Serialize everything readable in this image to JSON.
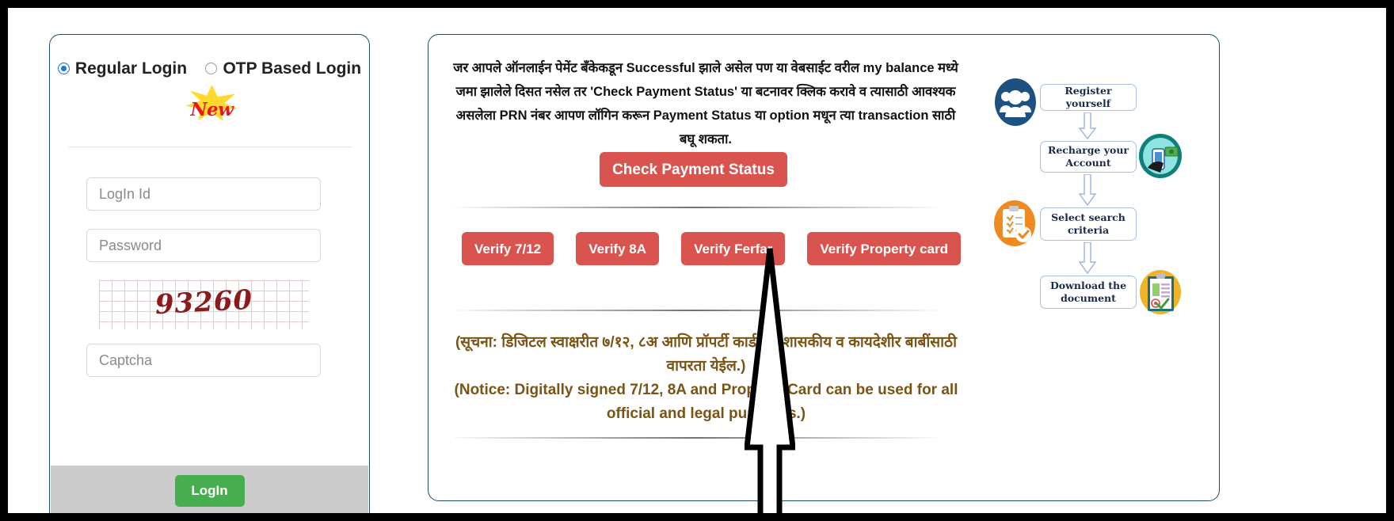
{
  "login": {
    "options": [
      {
        "label": "Regular Login",
        "selected": true
      },
      {
        "label": "OTP Based Login",
        "selected": false
      }
    ],
    "new_badge": "New",
    "fields": {
      "login_id_placeholder": "LogIn Id",
      "login_id_value": "",
      "password_placeholder": "Password",
      "password_value": "",
      "captcha_placeholder": "Captcha",
      "captcha_value": ""
    },
    "captcha_code": "93260",
    "submit_label": "LogIn"
  },
  "main": {
    "notice_marathi": "जर आपले ऑनलाईन पेमेंट बँकेकडून Successful झाले असेल पण या वेबसाईट वरील my balance मध्ये जमा झालेले दिसत नसेल तर 'Check Payment Status' या बटनावर क्लिक करावे व त्यासाठी आवश्यक असलेला PRN नंबर आपण लॉगिन करून Payment Status या option मधून त्या transaction साठी बघू शकता.",
    "check_payment_status_label": "Check Payment Status",
    "verify_buttons": [
      {
        "label": "Verify 7/12"
      },
      {
        "label": "Verify 8A"
      },
      {
        "label": "Verify Ferfar"
      },
      {
        "label": "Verify Property card"
      }
    ],
    "digital_notice_marathi": "(सूचना: डिजिटल स्वाक्षरीत ७/१२, ८अ आणि प्रॉपर्टी कार्ड सर्व शासकीय व कायदेशीर बाबींसाठी वापरता येईल.)",
    "digital_notice_english": "(Notice: Digitally signed 7/12, 8A and Property Card can be used for all official and legal purposes.)"
  },
  "infographic": {
    "steps": [
      {
        "label": "Register yourself",
        "icon": "people-group-icon"
      },
      {
        "label": "Recharge your Account",
        "icon": "mobile-payment-icon"
      },
      {
        "label": "Select search criteria",
        "icon": "checklist-clipboard-icon"
      },
      {
        "label": "Download the document",
        "icon": "document-download-icon"
      }
    ]
  },
  "colors": {
    "button_red": "#d9534f",
    "button_green": "#46ae4e",
    "panel_border": "#1b4f63",
    "notice_brown": "#7a5414",
    "radio_blue": "#1a73e8",
    "infographic_blue": "#1c5182",
    "infographic_orange": "#ef8a22"
  }
}
